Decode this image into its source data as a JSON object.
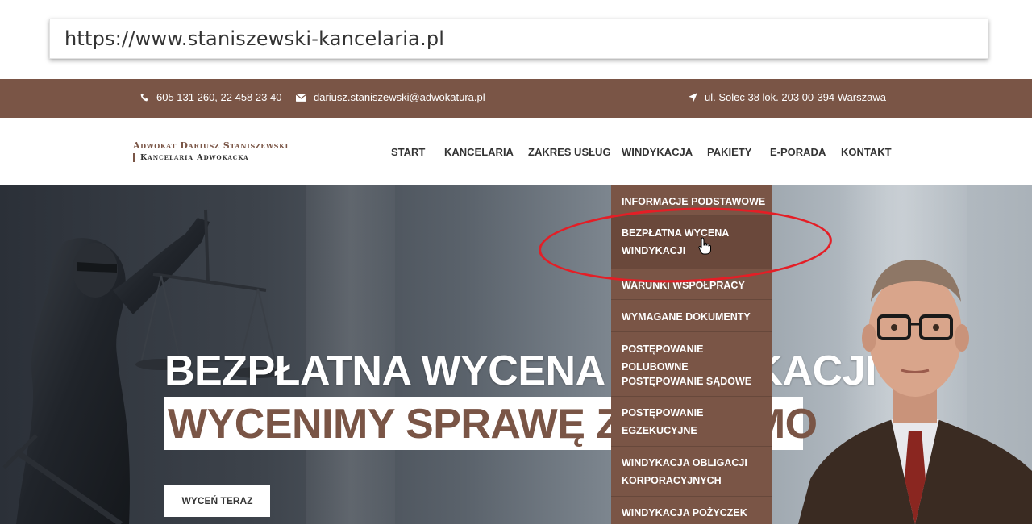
{
  "browser": {
    "url": "https://www.staniszewski-kancelaria.pl"
  },
  "topbar": {
    "phone": "605 131 260, 22 458 23 40",
    "email": "dariusz.staniszewski@adwokatura.pl",
    "address": "ul. Solec 38 lok. 203 00-394 Warszawa"
  },
  "logo": {
    "line1": "Adwokat Dariusz Staniszewski",
    "line2": "Kancelaria Adwokacka"
  },
  "nav": {
    "items": [
      "START",
      "KANCELARIA",
      "ZAKRES USŁUG",
      "WINDYKACJA",
      "PAKIETY",
      "E-PORADA",
      "KONTAKT"
    ]
  },
  "dropdown": {
    "items": [
      "INFORMACJE PODSTAWOWE",
      "BEZPŁATNA WYCENA WINDYKACJI",
      "WARUNKI WSPÓŁPRACY",
      "WYMAGANE DOKUMENTY",
      "POSTĘPOWANIE POLUBOWNE",
      "POSTĘPOWANIE SĄDOWE",
      "POSTĘPOWANIE EGZEKUCYJNE",
      "WINDYKACJA OBLIGACJI KORPORACYJNYCH",
      "WINDYKACJA POŻYCZEK"
    ],
    "active_index": 1
  },
  "hero": {
    "title": "BEZPŁATNA WYCENA WINDYKACJI",
    "subtitle": "WYCENIMY SPRAWĘ ZA DARMO",
    "button": "WYCEŃ TERAZ"
  },
  "colors": {
    "brand": "#7a5546",
    "highlight": "#e41e26"
  }
}
